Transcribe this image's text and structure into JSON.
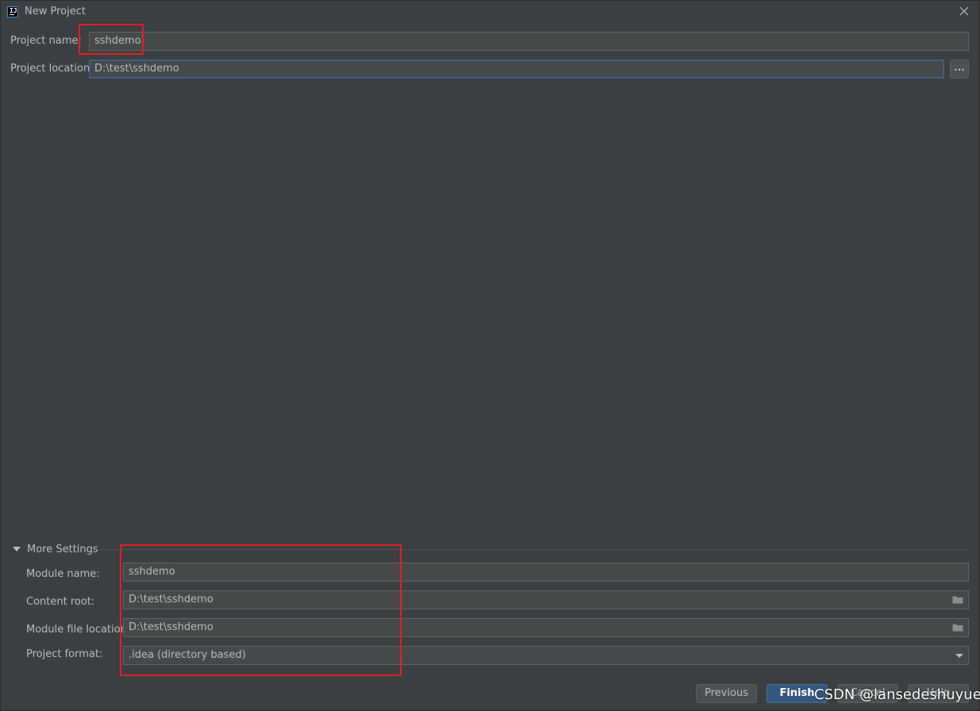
{
  "window": {
    "title": "New Project",
    "app_icon_text": "IJ"
  },
  "project": {
    "name_label": "Project name:",
    "name_value": "sshdemo",
    "location_label": "Project location:",
    "location_value": "D:\\test\\sshdemo",
    "browse_label": "..."
  },
  "more_settings": {
    "title": "More Settings",
    "expanded": true,
    "module_name_label": "Module name:",
    "module_name_value": "sshdemo",
    "content_root_label": "Content root:",
    "content_root_value": "D:\\test\\sshdemo",
    "module_file_location_label": "Module file location:",
    "module_file_location_value": "D:\\test\\sshdemo",
    "project_format_label": "Project format:",
    "project_format_value": ".idea (directory based)"
  },
  "buttons": {
    "previous": "Previous",
    "finish": "Finish",
    "cancel": "Cancel",
    "help": "Help"
  },
  "watermark": "CSDN @lansedeshuyue",
  "colors": {
    "background": "#3c3f41",
    "field": "#45494a",
    "accent": "#365880",
    "annotation": "#e21f26"
  }
}
